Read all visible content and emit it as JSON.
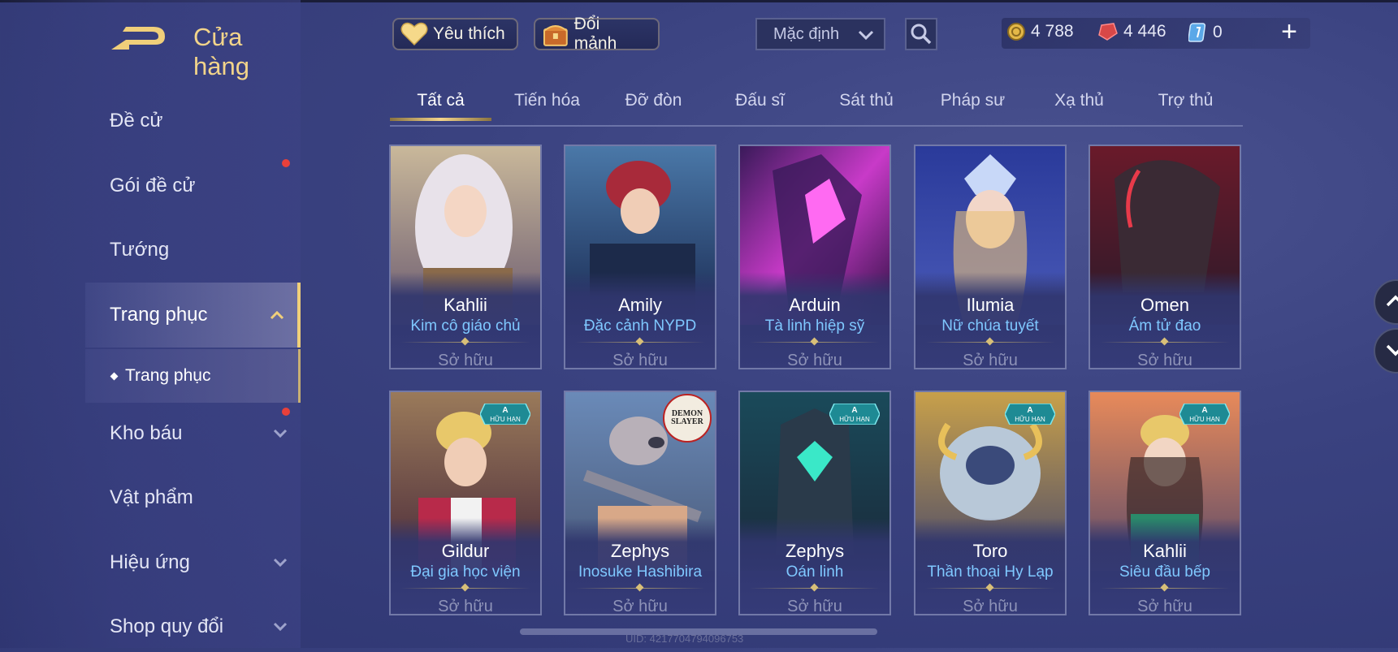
{
  "header": {
    "title": "Cửa hàng",
    "favorite_label": "Yêu thích",
    "exchange_label": "Đổi mảnh",
    "sort_value": "Mặc định",
    "currencies": [
      {
        "name": "gold",
        "icon": "gold-coin-icon",
        "value": "4 788"
      },
      {
        "name": "gem",
        "icon": "red-gem-icon",
        "value": "4 446"
      },
      {
        "name": "voucher",
        "icon": "voucher-icon",
        "value": "0"
      }
    ]
  },
  "sidebar": {
    "items": [
      {
        "label": "Đề cử"
      },
      {
        "label": "Gói đề cử"
      },
      {
        "label": "Tướng"
      },
      {
        "label": "Trang phục"
      },
      {
        "label": "Kho báu"
      },
      {
        "label": "Vật phẩm"
      },
      {
        "label": "Hiệu ứng"
      },
      {
        "label": "Shop quy đổi"
      }
    ],
    "sub_item": "Trang phục"
  },
  "tabs": [
    "Tất cả",
    "Tiến hóa",
    "Đỡ đòn",
    "Đấu sĩ",
    "Sát thủ",
    "Pháp sư",
    "Xạ thủ",
    "Trợ thủ"
  ],
  "cards": [
    {
      "hero": "Kahlii",
      "skin": "Kim cô giáo chủ",
      "status": "Sở hữu"
    },
    {
      "hero": "Amily",
      "skin": "Đặc cảnh NYPD",
      "status": "Sở hữu"
    },
    {
      "hero": "Arduin",
      "skin": "Tà linh hiệp sỹ",
      "status": "Sở hữu"
    },
    {
      "hero": "Ilumia",
      "skin": "Nữ chúa tuyết",
      "status": "Sở hữu"
    },
    {
      "hero": "Omen",
      "skin": "Ám tử đao",
      "status": "Sở hữu"
    },
    {
      "hero": "Gildur",
      "skin": "Đại gia học viện",
      "status": "Sở hữu",
      "badge_rank": "A",
      "badge_text": "HỮU HẠN"
    },
    {
      "hero": "Zephys",
      "skin": "Inosuke Hashibira",
      "status": "Sở hữu",
      "collab": [
        "DEMON",
        "SLAYER"
      ]
    },
    {
      "hero": "Zephys",
      "skin": "Oán linh",
      "status": "Sở hữu",
      "badge_rank": "A",
      "badge_text": "HỮU HẠN"
    },
    {
      "hero": "Toro",
      "skin": "Thần thoại Hy Lạp",
      "status": "Sở hữu",
      "badge_rank": "A",
      "badge_text": "HỮU HẠN"
    },
    {
      "hero": "Kahlii",
      "skin": "Siêu đầu bếp",
      "status": "Sở hữu",
      "badge_rank": "A",
      "badge_text": "HỮU HẠN"
    }
  ],
  "footer": {
    "uid": "UID: 4217704794096753"
  },
  "colors": {
    "accent_gold": "#f2d48a",
    "skin_name": "#7fc8ff",
    "owned_text": "#8e93b8",
    "badge_teal": "#2aa8b0"
  }
}
